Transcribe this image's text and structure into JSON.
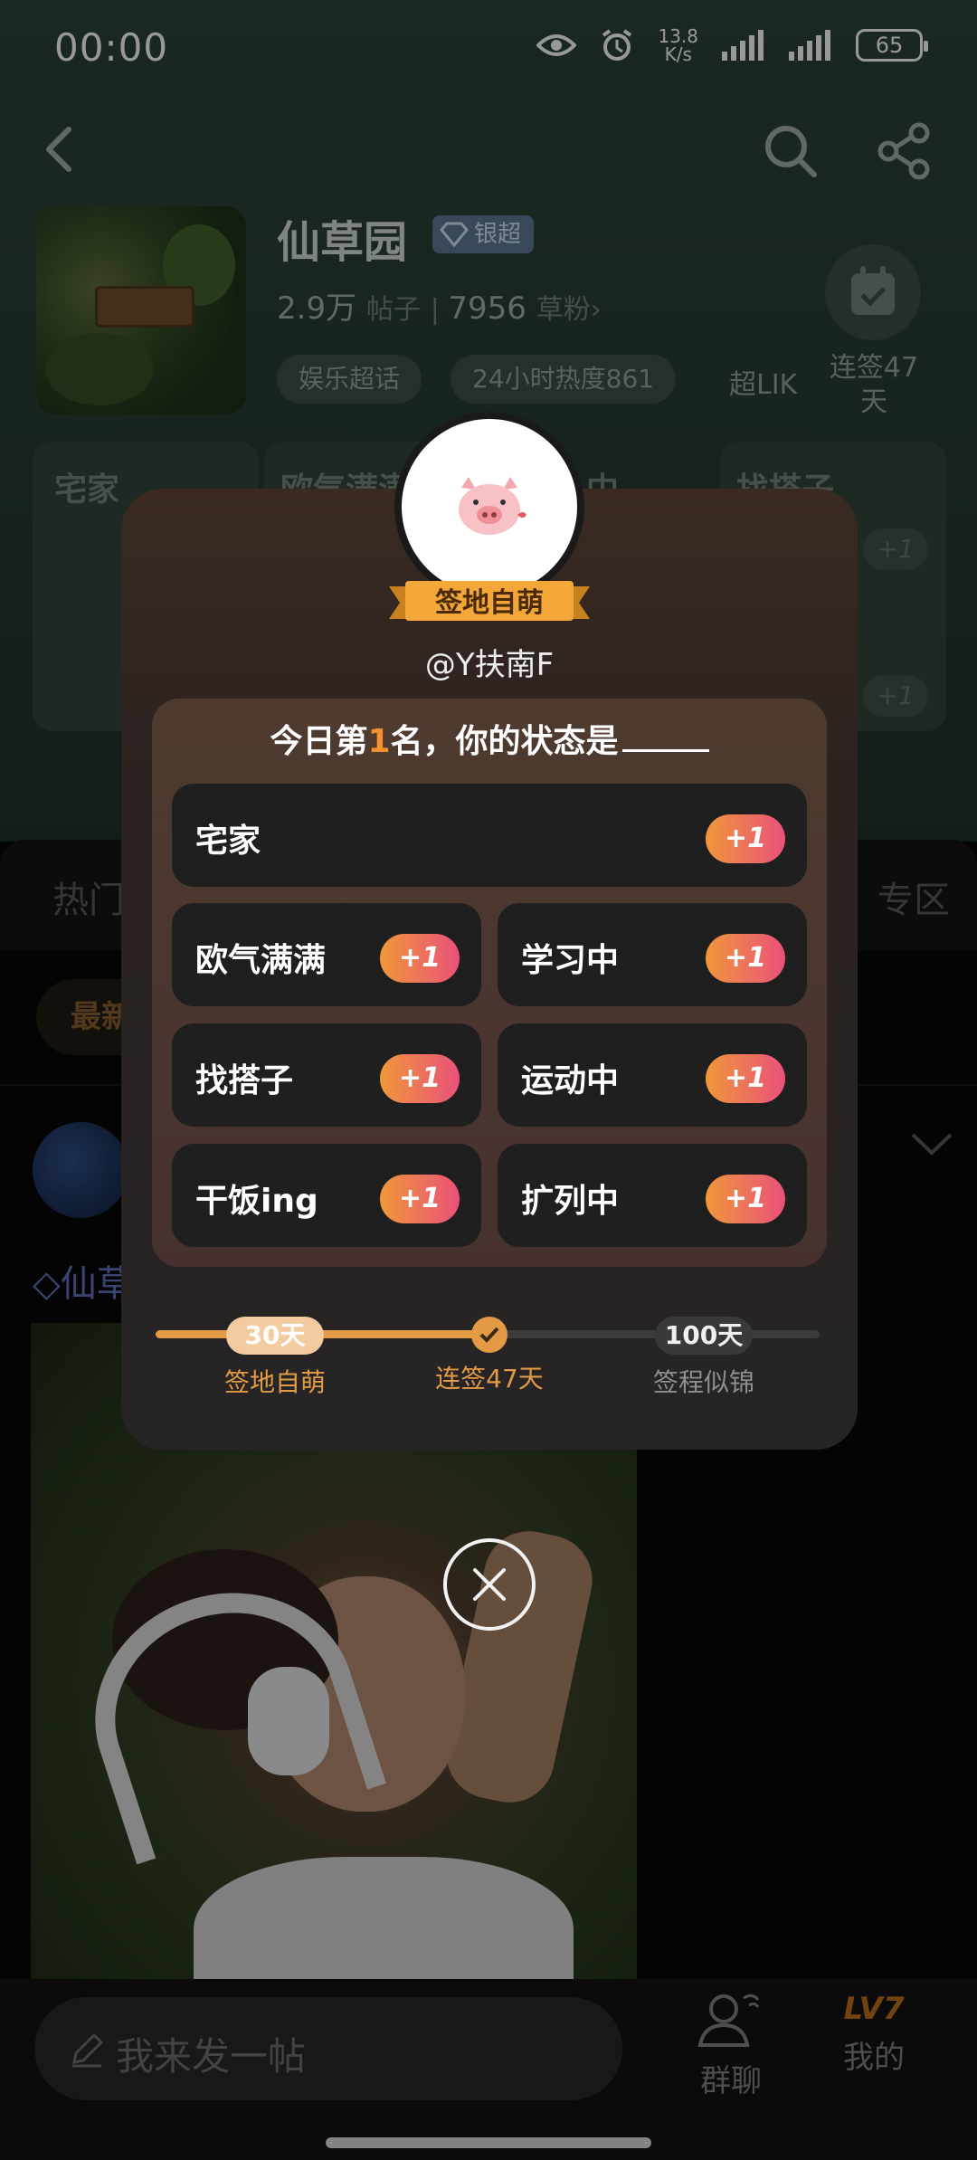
{
  "status_bar": {
    "time": "00:00",
    "net_speed": "13.8\nK/s",
    "battery": "65"
  },
  "forum": {
    "name": "仙草园",
    "badge": "银超",
    "posts_count": "2.9万",
    "posts_label": "帖子",
    "fans_count": "7956",
    "fans_label": "草粉",
    "tags": [
      "娱乐超话",
      "24小时热度861"
    ],
    "lik": "超LIK",
    "checkin_days": "连签47天"
  },
  "background_cards": [
    "宅家",
    "欧气满满",
    "中",
    "找搭子"
  ],
  "tabs": {
    "hot": "热门",
    "zone": "专区"
  },
  "filter": {
    "latest": "最新"
  },
  "post": {
    "forum_tag": "仙草"
  },
  "bottom": {
    "compose_placeholder": "我来发一帖",
    "group_chat": "群聊",
    "mine": "我的",
    "level": "LV7"
  },
  "modal": {
    "title_ribbon": "签地自萌",
    "username": "@Y扶南F",
    "question_prefix": "今日第",
    "rank": "1",
    "question_suffix": "名，你的状态是",
    "options": [
      {
        "label": "宅家",
        "plus": "+1"
      },
      {
        "label": "欧气满满",
        "plus": "+1"
      },
      {
        "label": "学习中",
        "plus": "+1"
      },
      {
        "label": "找搭子",
        "plus": "+1"
      },
      {
        "label": "运动中",
        "plus": "+1"
      },
      {
        "label": "干饭ing",
        "plus": "+1"
      },
      {
        "label": "扩列中",
        "plus": "+1"
      }
    ],
    "milestones": [
      {
        "pill": "30天",
        "label": "签地自萌"
      },
      {
        "pill": "",
        "label": "连签47天"
      },
      {
        "pill": "100天",
        "label": "签程似锦"
      }
    ],
    "progress_days": 47,
    "progress_max_days": 100
  },
  "icons": {
    "back": "chevron-left-icon",
    "search": "search-icon",
    "share": "share-icon",
    "calendar": "calendar-check-icon",
    "close": "close-icon",
    "pencil": "pencil-icon",
    "group": "group-chat-icon"
  },
  "colors": {
    "accent_orange": "#f5922f",
    "plus_gradient_start": "#f0973a",
    "plus_gradient_end": "#e9517a"
  }
}
